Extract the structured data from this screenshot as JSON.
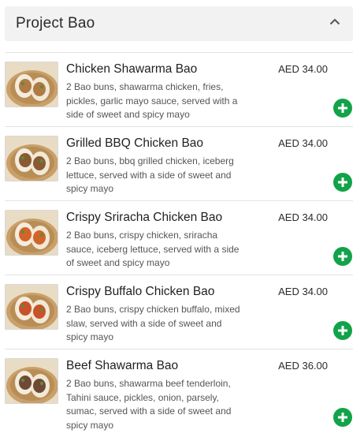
{
  "section": {
    "title": "Project Bao",
    "collapse_icon": "chevron-up-icon"
  },
  "items": [
    {
      "name": "Chicken Shawarma Bao",
      "description": "2 Bao buns, shawarma chicken, fries, pickles, garlic mayo sauce, served with a side of sweet and spicy mayo",
      "price": "AED 34.00",
      "filling": "#b07a45"
    },
    {
      "name": "Grilled BBQ Chicken Bao",
      "description": "2 Bao buns, bbq grilled chicken, iceberg lettuce, served with a side of sweet and spicy mayo",
      "price": "AED 34.00",
      "filling": "#8a5a32"
    },
    {
      "name": "Crispy Sriracha Chicken Bao",
      "description": "2 Bao buns, crispy chicken, sriracha sauce, iceberg lettuce, served with a side of sweet and spicy mayo",
      "price": "AED 34.00",
      "filling": "#d2642a"
    },
    {
      "name": "Crispy Buffalo Chicken Bao",
      "description": "2 Bao buns, crispy chicken buffalo, mixed slaw, served with a side of sweet and spicy mayo",
      "price": "AED 34.00",
      "filling": "#c9522a"
    },
    {
      "name": "Beef Shawarma Bao",
      "description": "2 Bao buns, shawarma beef tenderloin, Tahini sauce, pickles, onion, parsely, sumac, served with a side of sweet and spicy mayo",
      "price": "AED 36.00",
      "filling": "#6e4a35"
    }
  ],
  "colors": {
    "add_button": "#12a34a",
    "header_bg": "#f2f2f2"
  }
}
